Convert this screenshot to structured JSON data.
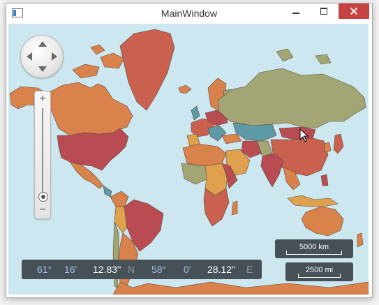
{
  "window": {
    "title": "MainWindow"
  },
  "map": {
    "ocean_color": "#cde7f0",
    "region_colors": [
      "#d9824b",
      "#c9614e",
      "#b94b52",
      "#a3a574",
      "#5e9aa6",
      "#e0a14f"
    ]
  },
  "navigation": {
    "icon": "pan-navigator-icon"
  },
  "zoom": {
    "plus_label": "+",
    "minus_label": "−",
    "level_fraction": 0.97
  },
  "coordinates": {
    "lat_deg": "61°",
    "lat_min": "16'",
    "lat_sec": "12.83''",
    "lat_dir": "N",
    "lon_deg": "58°",
    "lon_min": "0'",
    "lon_sec": "28.12''",
    "lon_dir": "E"
  },
  "scale": {
    "km_label": "5000 km",
    "mi_label": "2500 mi"
  }
}
